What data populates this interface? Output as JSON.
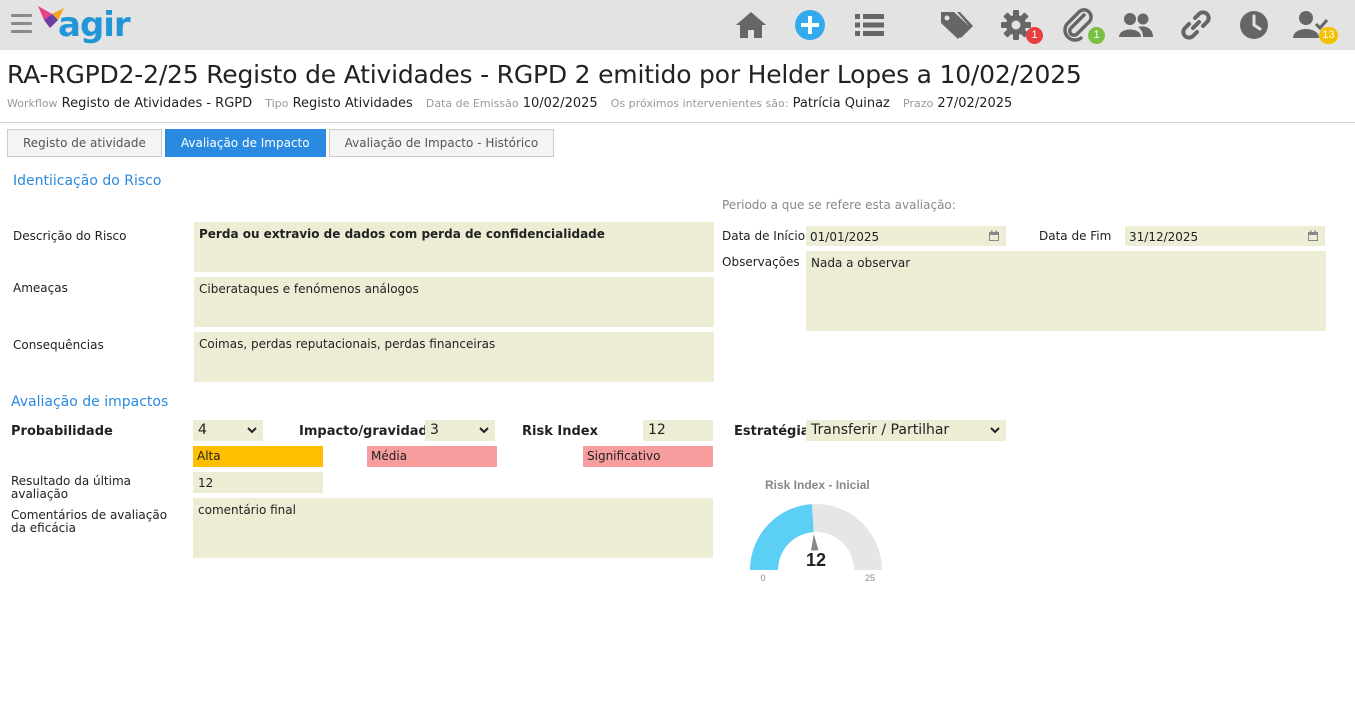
{
  "app": {
    "logo_text": "agir"
  },
  "toolbar": {
    "badges": {
      "settings": "1",
      "attachments": "1",
      "tasks": "13"
    },
    "colors": {
      "icon": "#666666",
      "add": "#33aaee",
      "badge_red": "#e84040",
      "badge_green": "#7ac143",
      "badge_yellow": "#f2c200"
    }
  },
  "doc": {
    "title": "RA-RGPD2-2/25 Registo de Atividades - RGPD 2 emitido por Helder Lopes a 10/02/2025",
    "workflow_label": "Workflow",
    "workflow": "Registo de Atividades - RGPD",
    "tipo_label": "Tipo",
    "tipo": "Registo Atividades",
    "emissao_label": "Data de Emissão",
    "emissao": "10/02/2025",
    "intervenientes_label": "Os próximos intervenientes são:",
    "intervenientes": "Patrícia Quinaz",
    "prazo_label": "Prazo",
    "prazo": "27/02/2025"
  },
  "tabs": [
    {
      "label": "Registo de atividade"
    },
    {
      "label": "Avaliação de Impacto"
    },
    {
      "label": "Avaliação de Impacto - Histórico"
    }
  ],
  "risk": {
    "heading": "Identiicação do Risco",
    "descricao_label": "Descrição do Risco",
    "descricao": "Perda ou extravio de dados com perda de confidencialidade",
    "ameacas_label": "Ameaças",
    "ameacas": "Ciberataques e fenómenos análogos",
    "consequencias_label": "Consequências",
    "consequencias": "Coimas, perdas reputacionais, perdas financeiras"
  },
  "period": {
    "heading": "Periodo a que se refere esta avaliação:",
    "inicio_label": "Data de Início",
    "inicio": "01/01/2025",
    "fim_label": "Data de Fim",
    "fim": "31/12/2025",
    "obs_label": "Observações",
    "obs": "Nada a observar"
  },
  "impact": {
    "heading": "Avaliação de impactos",
    "prob_label": "Probabilidade",
    "prob": "4",
    "prob_level": "Alta",
    "prob_color": "#ffbf00",
    "grav_label": "Impacto/gravidade",
    "grav": "3",
    "grav_level": "Média",
    "grav_color": "#f79d9d",
    "risk_label": "Risk Index",
    "risk": "12",
    "risk_level": "Significativo",
    "risk_color": "#f79d9d",
    "estrategia_label": "Estratégia",
    "estrategia": "Transferir / Partilhar",
    "ultima_label": "Resultado da última avaliação",
    "ultima": "12",
    "coment_label": "Comentários de avaliação da eficácia",
    "coment": "comentário final"
  },
  "gauge": {
    "title": "Risk Index - Inicial",
    "value": 12,
    "min": 0,
    "max": 25,
    "value_label": "12",
    "min_label": "0",
    "max_label": "25",
    "fill_color": "#5ccff5",
    "track_color": "#e6e6e6"
  }
}
